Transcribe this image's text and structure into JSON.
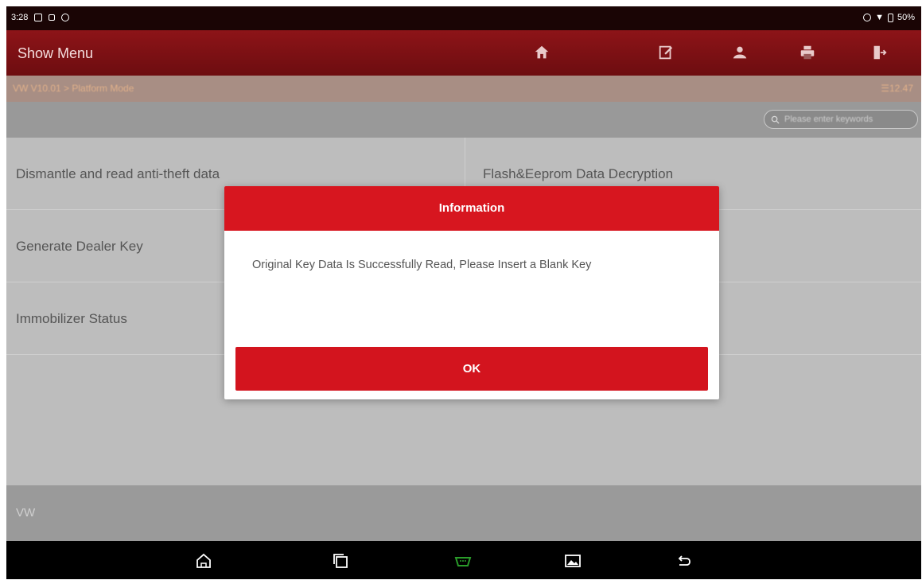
{
  "status_bar": {
    "time": "3:28",
    "battery": "50%"
  },
  "header": {
    "title": "Show Menu"
  },
  "breadcrumb": {
    "path": "VW V10.01 > Platform Mode",
    "version": "12.47"
  },
  "search": {
    "placeholder": "Please enter keywords"
  },
  "menu": {
    "items": [
      "Dismantle and read anti-theft data",
      "Flash&Eeprom Data Decryption",
      "Generate Dealer Key",
      "Immobilizer Status"
    ]
  },
  "brand": {
    "label": "VW"
  },
  "dialog": {
    "title": "Information",
    "message": "Original Key Data Is Successfully Read, Please Insert a Blank Key",
    "ok_label": "OK"
  },
  "colors": {
    "accent": "#d7161f",
    "header": "#7d1114",
    "nav_active": "#2a9d2a"
  }
}
